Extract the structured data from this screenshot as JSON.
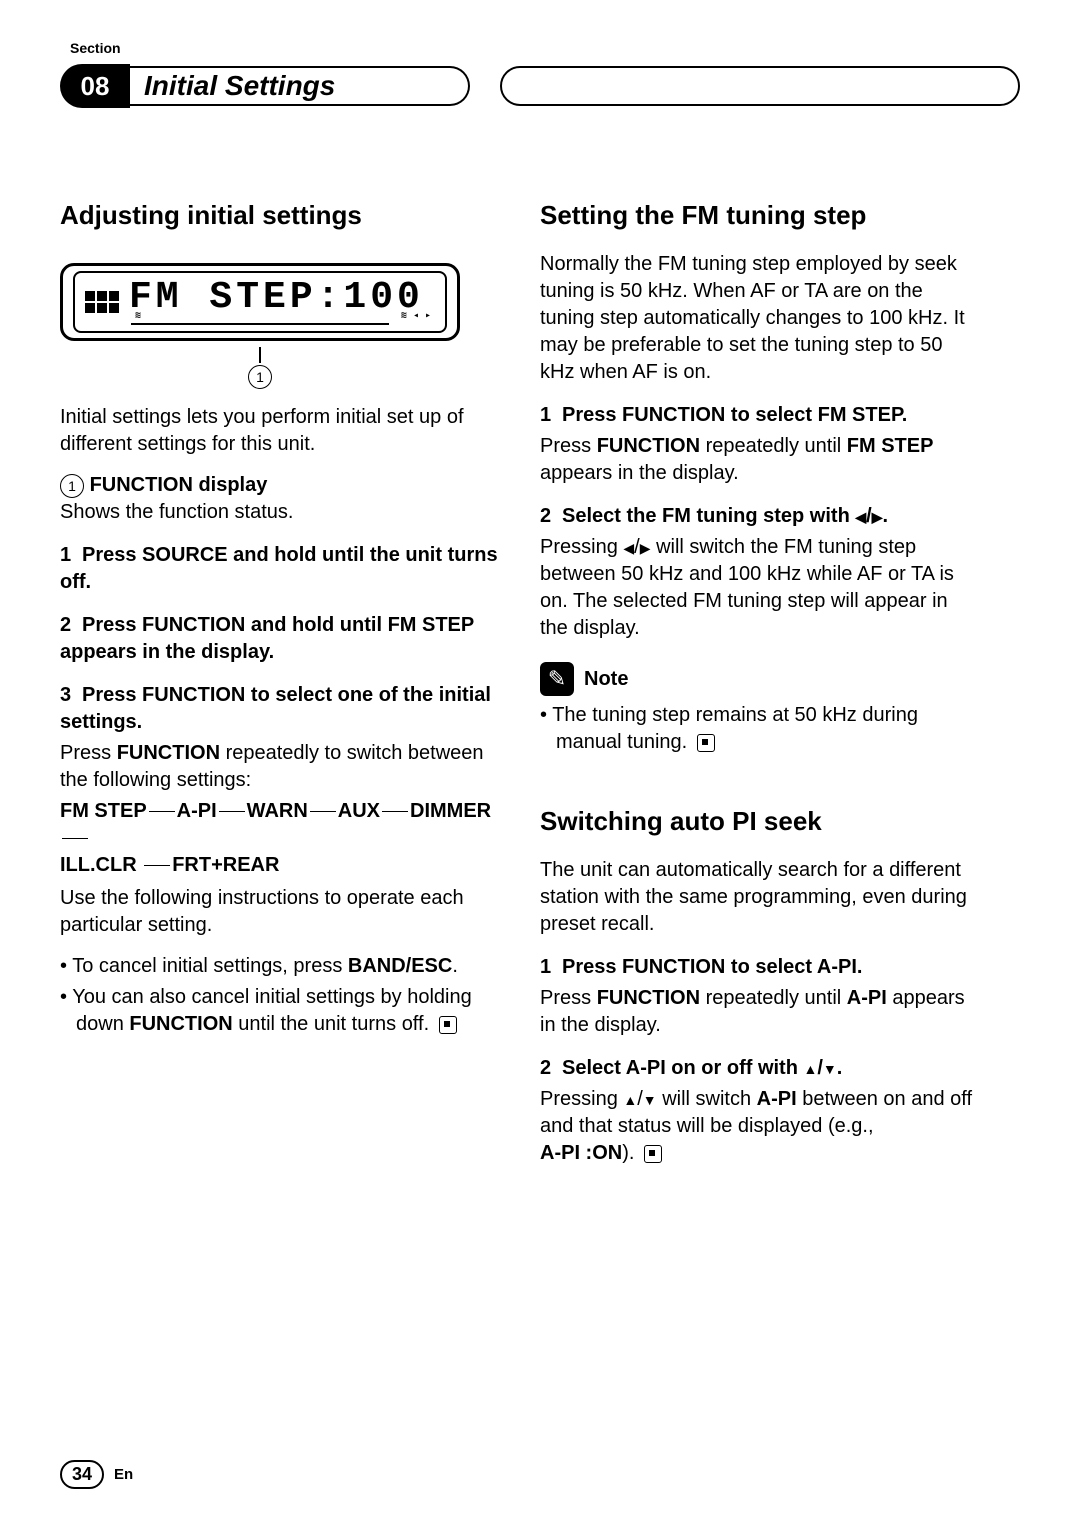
{
  "section_label": "Section",
  "chapter_number": "08",
  "chapter_title": "Initial Settings",
  "left": {
    "h1": "Adjusting initial settings",
    "lcd_text": "FM STEP:100",
    "callout_num": "1",
    "intro": "Initial settings lets you perform initial set up of different settings for this unit.",
    "func_display_num": "1",
    "func_display_label": "FUNCTION display",
    "func_display_desc": "Shows the function status.",
    "step1": "Press SOURCE and hold until the unit turns off.",
    "step2": "Press FUNCTION and hold until FM STEP appears in the display.",
    "step3": "Press FUNCTION to select one of the initial settings.",
    "step3_desc_a": "Press ",
    "step3_desc_b": " repeatedly to switch between the following settings:",
    "step3_function": "FUNCTION",
    "seq": [
      "FM STEP",
      "A-PI",
      "WARN",
      "AUX",
      "DIMMER",
      "ILL.CLR",
      "FRT+REAR"
    ],
    "seq_tail": "Use the following instructions to operate each particular setting.",
    "b1_a": "To cancel initial settings, press ",
    "b1_b": "BAND/ESC",
    "b1_c": ".",
    "b2_a": "You can also cancel initial settings by holding down ",
    "b2_b": "FUNCTION",
    "b2_c": " until the unit turns off."
  },
  "right": {
    "h1": "Setting the FM tuning step",
    "intro": "Normally the FM tuning step employed by seek tuning is 50 kHz. When AF or TA are on the tuning step automatically changes to 100 kHz. It may be preferable to set the tuning step to 50 kHz when AF is on.",
    "s1_head": "Press FUNCTION to select FM STEP.",
    "s1_a": "Press ",
    "s1_func": "FUNCTION",
    "s1_b": " repeatedly until ",
    "s1_fm": "FM STEP",
    "s1_c": " appears in the display.",
    "s2_head_a": "Select the FM tuning step with ",
    "s2_head_b": ".",
    "s2_body": "will switch the FM tuning step between 50 kHz and 100 kHz while AF or TA is on. The selected FM tuning step will appear in the display.",
    "s2_body_pre": "Pressing ",
    "note_label": "Note",
    "note_body": "The tuning step remains at 50 kHz during manual tuning.",
    "h2": "Switching auto PI seek",
    "h2_intro": "The unit can automatically search for a different station with the same programming, even during preset recall.",
    "p1_head": "Press FUNCTION to select A-PI.",
    "p1_a": "Press ",
    "p1_func": "FUNCTION",
    "p1_b": " repeatedly until ",
    "p1_api": "A-PI",
    "p1_c": " appears in the display.",
    "p2_head_a": "Select ",
    "p2_head_api": "A-PI",
    "p2_head_b": " on or off with ",
    "p2_head_c": ".",
    "p2_body_a": "Pressing ",
    "p2_body_b": " will switch ",
    "p2_body_api": "A-PI",
    "p2_body_c": " between on and off and that status will be displayed (e.g., ",
    "p2_body_d": "A-PI :ON",
    "p2_body_e": ")."
  },
  "footer": {
    "page": "34",
    "lang": "En"
  }
}
